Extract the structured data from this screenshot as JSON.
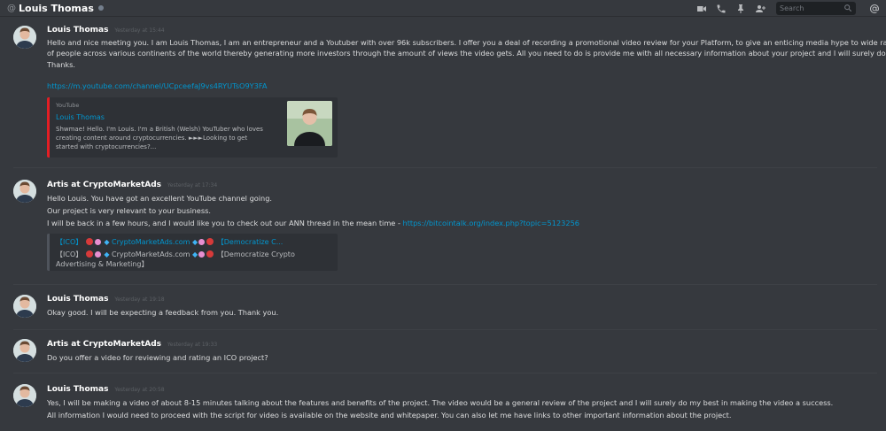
{
  "header": {
    "at_symbol": "@",
    "channel_name": "Louis Thomas",
    "search_placeholder": "Search"
  },
  "messages": [
    {
      "author": "Louis Thomas",
      "timestamp": "Yesterday at 15:44",
      "lines": [
        "Hello and nice meeting you. I am Louis Thomas, I am an entrepreneur and a Youtuber with over 96k subscribers. I offer you a deal of recording a promotional video review for your Platform, to give an enticing media hype to wide range",
        "of people across various continents of the world thereby generating more investors through the amount of views the video gets. All you need to do is provide me with all necessary information about your project and I will surely do my best.",
        "Thanks."
      ],
      "link": "https://m.youtube.com/channel/UCpceefaJ9vs4RYUTsO9Y3FA",
      "embed": {
        "provider": "YouTube",
        "title": "Louis Thomas",
        "description_1": "Shwmae! Hello. I'm Louis. I'm a British (Welsh) YouTuber who loves",
        "description_2": "creating content around cryptocurrencies. ►►►Looking to get",
        "description_3": "started with cryptocurrencies?..."
      }
    },
    {
      "author": "Artis at CryptoMarketAds",
      "timestamp": "Yesterday at 17:34",
      "lines": [
        "Hello Louis. You have got an excellent YouTube channel going.",
        "Our project is very relevant to your business.",
        "I will be back in a few hours, and I would like you to check out our ANN thread in the mean time - "
      ],
      "link": "https://bitcointalk.org/index.php?topic=5123256",
      "embed": {
        "title_prefix": "【ICO】",
        "title_site": "CryptoMarketAds.com",
        "title_suffix": "【Democratize C...",
        "desc_prefix": "【ICO】",
        "desc_site": "CryptoMarketAds.com",
        "desc_suffix": "【Democratize Crypto",
        "desc_line2": "Advertising & Marketing】"
      }
    },
    {
      "author": "Louis Thomas",
      "timestamp": "Yesterday at 19:18",
      "lines": [
        "Okay good. I will be expecting a feedback from you. Thank you."
      ]
    },
    {
      "author": "Artis at CryptoMarketAds",
      "timestamp": "Yesterday at 19:33",
      "lines": [
        "Do you offer a video for reviewing and rating an ICO project?"
      ]
    },
    {
      "author": "Louis Thomas",
      "timestamp": "Yesterday at 20:58",
      "lines": [
        "Yes, I will be making a video of about 8-15 minutes talking about the features and benefits of the project. The video would be a general review of the project and I will surely do my best in making the video a success.",
        "All information I would need to proceed with the script for video is available on the website and whitepaper. You can also let me have links to other important information about the project."
      ]
    }
  ],
  "colors": {
    "background": "#36393e",
    "link": "#0096cf",
    "youtube_accent": "#e31e24"
  },
  "icons": [
    "video-call-icon",
    "voice-call-icon",
    "pin-icon",
    "add-friend-icon",
    "search-icon",
    "mention-icon"
  ]
}
